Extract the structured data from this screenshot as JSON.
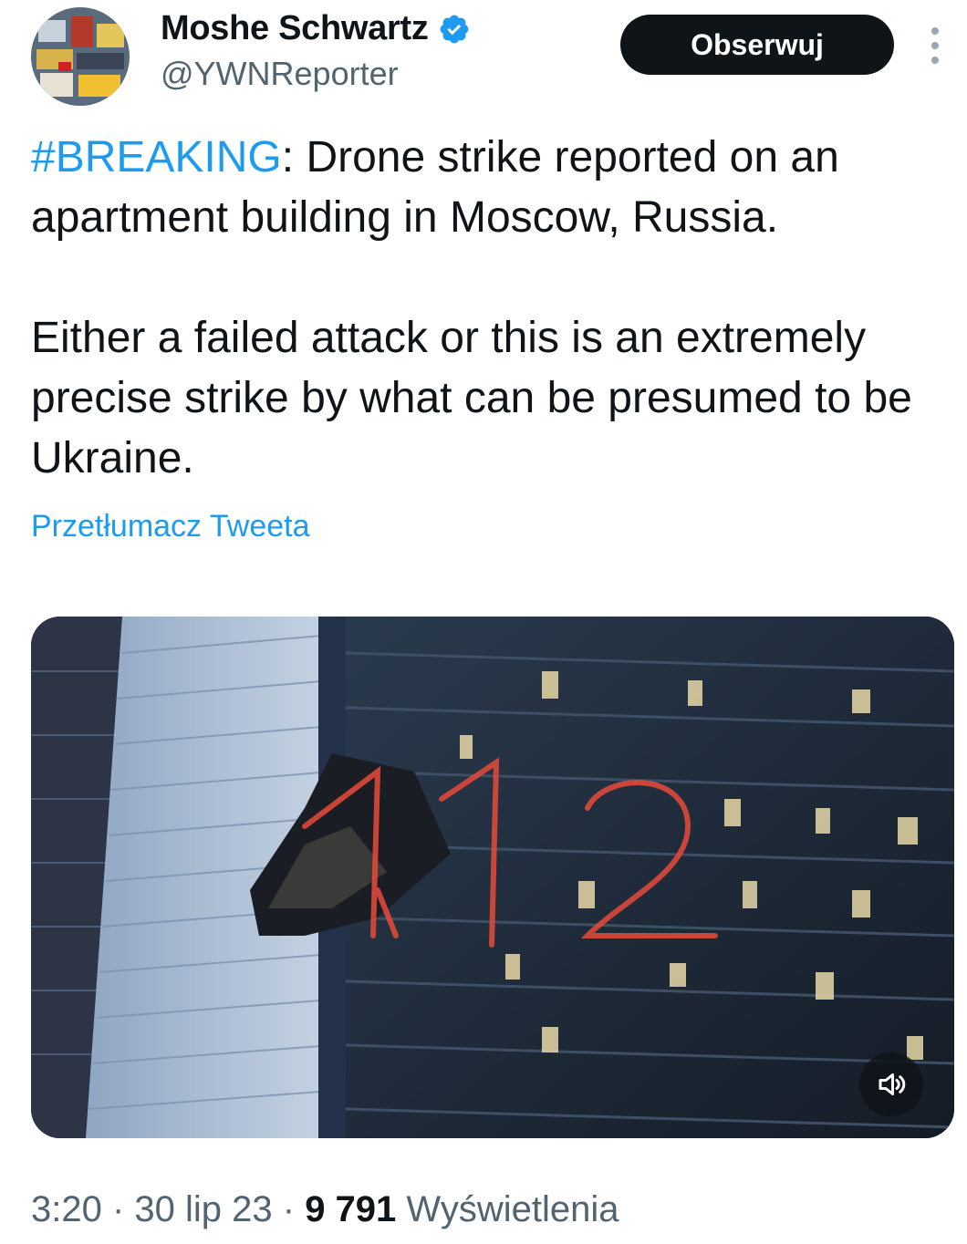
{
  "author": {
    "display_name": "Moshe Schwartz",
    "handle": "@YWNReporter",
    "verified": true,
    "verified_icon": "verified-badge-icon"
  },
  "header": {
    "follow_label": "Obserwuj",
    "more_icon": "more-vertical-icon"
  },
  "tweet": {
    "hashtag": "#BREAKING",
    "line1_rest": ": Drone strike reported on an apartment building in Moscow, Russia.",
    "paragraph2": "Either a failed attack or this is an extremely precise strike by what can be presumed to be Ukraine.",
    "translate_label": "Przetłumacz Tweeta"
  },
  "media": {
    "overlay_text": "1 2",
    "sound_icon": "speaker-sound-icon"
  },
  "meta": {
    "time": "3:20",
    "sep1": " · ",
    "date": "30 lip 23",
    "sep2": " · ",
    "views_count": "9 791",
    "views_label": " Wyświetlenia"
  },
  "colors": {
    "accent": "#1d9bf0",
    "text_primary": "#0f1419",
    "text_secondary": "#536471",
    "button_bg": "#0f1419"
  }
}
